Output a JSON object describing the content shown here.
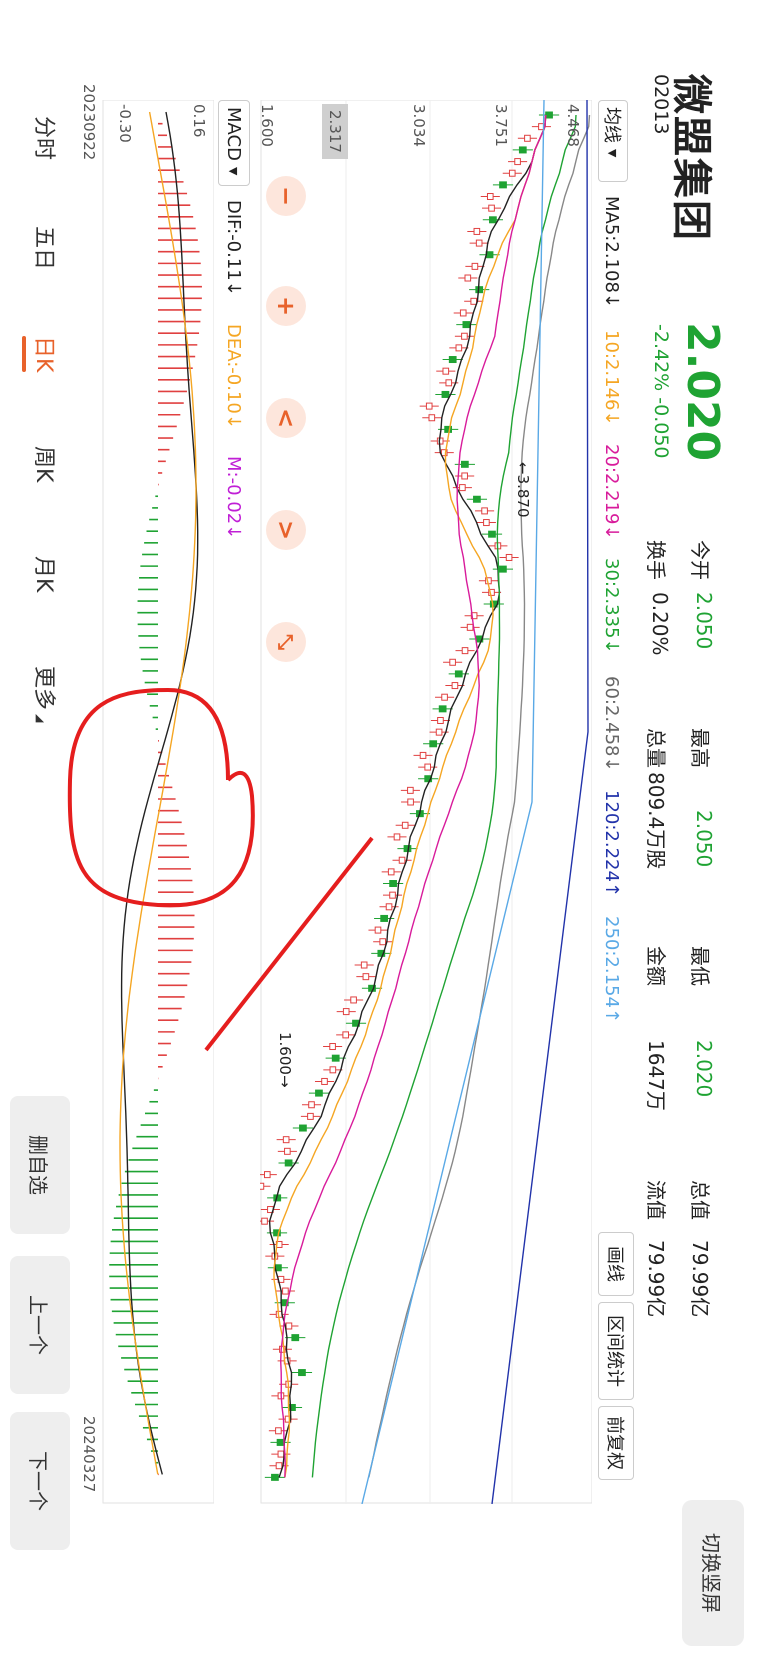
{
  "stock": {
    "name": "微盟集团",
    "code": "02013",
    "price": "2.020",
    "change": "-2.42% -0.050",
    "stats": [
      {
        "label": "今开",
        "value": "2.050",
        "color": "green"
      },
      {
        "label": "最高",
        "value": "2.050",
        "color": "green"
      },
      {
        "label": "最低",
        "value": "2.020",
        "color": "green"
      },
      {
        "label": "换手",
        "value": "0.20%",
        "color": "dark"
      },
      {
        "label": "总量",
        "value": "809.4万股",
        "color": "dark"
      },
      {
        "label": "金额",
        "value": "1647万",
        "color": "dark"
      }
    ],
    "market": {
      "total_label": "总值",
      "total_value": "79.99亿",
      "float_label": "流值",
      "float_value": "79.99亿"
    }
  },
  "header": {
    "switch_label": "切换竖屏"
  },
  "ma_bar": {
    "selector": "均线",
    "items": [
      {
        "text": "MA5:2.108↓",
        "color": "#222222"
      },
      {
        "text": "10:2.146↓",
        "color": "#f5a623"
      },
      {
        "text": "20:2.219↓",
        "color": "#d81b9b"
      },
      {
        "text": "30:2.335↓",
        "color": "#1fa333"
      },
      {
        "text": "60:2.458↓",
        "color": "#666666"
      },
      {
        "text": "120:2.224↑",
        "color": "#2233aa"
      },
      {
        "text": "250:2.154↑",
        "color": "#5aa9e6"
      }
    ],
    "tools": {
      "draw": "画线",
      "range": "区间统计",
      "adjust": "前复权"
    }
  },
  "chart": {
    "price_axis": [
      "4.468",
      "3.751",
      "3.034",
      "2.317",
      "1.600"
    ],
    "high_marker": "3.870",
    "low_marker": "1.600",
    "macd_selector": "MACD",
    "macd_values": [
      {
        "text": "DIF:-0.11↓",
        "color": "#222222"
      },
      {
        "text": "DEA:-0.10↓",
        "color": "#f5a623"
      },
      {
        "text": "M:-0.02↓",
        "color": "#c01fd6"
      }
    ],
    "macd_axis": [
      "0.16",
      "-0.30"
    ],
    "date_start": "20230922",
    "date_end": "20240327"
  },
  "controls": {
    "zoom_out": "−",
    "zoom_in": "+",
    "left": "<",
    "right": ">",
    "expand": "⤡"
  },
  "tabs": {
    "items": [
      "分时",
      "五日",
      "日K",
      "周K",
      "月K",
      "更多"
    ],
    "active_index": 2
  },
  "bottom_buttons": {
    "delete": "删自选",
    "prev": "上一个",
    "next": "下一个"
  },
  "colors": {
    "up": "#e04040",
    "down": "#1fa333",
    "accent": "#e8622b"
  }
}
